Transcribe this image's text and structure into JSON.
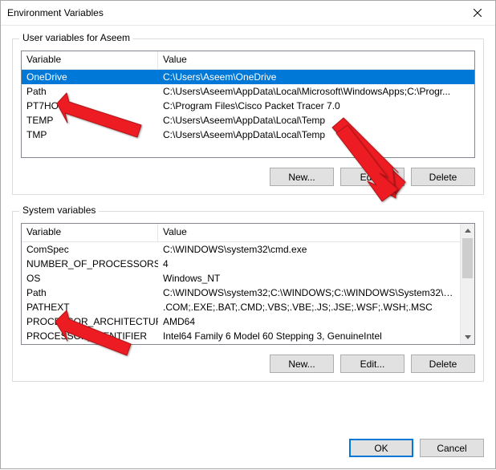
{
  "window": {
    "title": "Environment Variables"
  },
  "user_group": {
    "title": "User variables for Aseem",
    "header_variable": "Variable",
    "header_value": "Value",
    "rows": [
      {
        "name": "OneDrive",
        "value": "C:\\Users\\Aseem\\OneDrive"
      },
      {
        "name": "Path",
        "value": "C:\\Users\\Aseem\\AppData\\Local\\Microsoft\\WindowsApps;C:\\Progr..."
      },
      {
        "name": "PT7HOME",
        "value": "C:\\Program Files\\Cisco Packet Tracer 7.0"
      },
      {
        "name": "TEMP",
        "value": "C:\\Users\\Aseem\\AppData\\Local\\Temp"
      },
      {
        "name": "TMP",
        "value": "C:\\Users\\Aseem\\AppData\\Local\\Temp"
      }
    ],
    "buttons": {
      "new": "New...",
      "edit": "Edit...",
      "delete": "Delete"
    }
  },
  "system_group": {
    "title": "System variables",
    "header_variable": "Variable",
    "header_value": "Value",
    "rows": [
      {
        "name": "ComSpec",
        "value": "C:\\WINDOWS\\system32\\cmd.exe"
      },
      {
        "name": "NUMBER_OF_PROCESSORS",
        "value": "4"
      },
      {
        "name": "OS",
        "value": "Windows_NT"
      },
      {
        "name": "Path",
        "value": "C:\\WINDOWS\\system32;C:\\WINDOWS;C:\\WINDOWS\\System32\\Wb..."
      },
      {
        "name": "PATHEXT",
        "value": ".COM;.EXE;.BAT;.CMD;.VBS;.VBE;.JS;.JSE;.WSF;.WSH;.MSC"
      },
      {
        "name": "PROCESSOR_ARCHITECTURE",
        "value": "AMD64"
      },
      {
        "name": "PROCESSOR_IDENTIFIER",
        "value": "Intel64 Family 6 Model 60 Stepping 3, GenuineIntel"
      }
    ],
    "buttons": {
      "new": "New...",
      "edit": "Edit...",
      "delete": "Delete"
    }
  },
  "footer": {
    "ok": "OK",
    "cancel": "Cancel"
  }
}
